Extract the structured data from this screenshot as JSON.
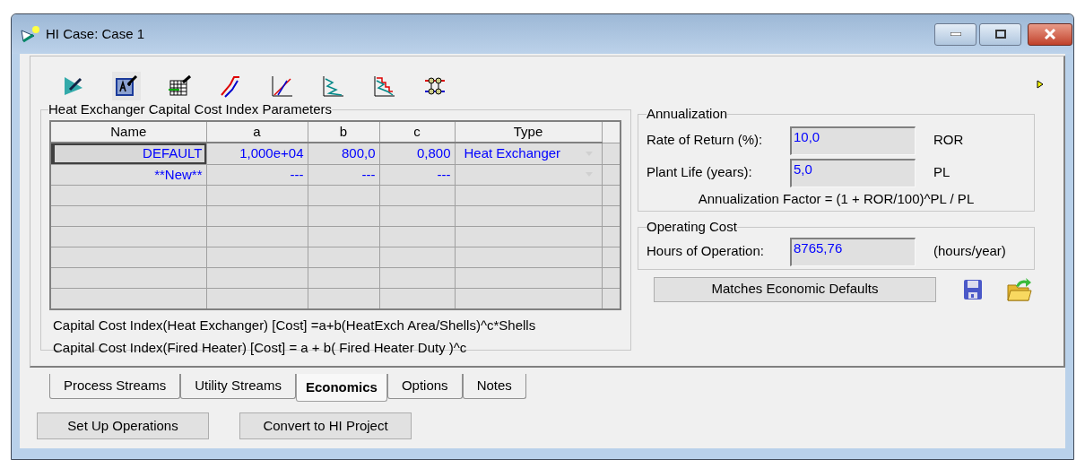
{
  "window": {
    "title": "HI Case: Case 1"
  },
  "capital_cost": {
    "title": "Heat Exchanger Capital Cost Index Parameters",
    "columns": [
      "Name",
      "a",
      "b",
      "c",
      "Type"
    ],
    "rows": [
      {
        "name": "DEFAULT",
        "a": "1,000e+04",
        "b": "800,0",
        "c": "0,800",
        "type": "Heat Exchanger",
        "selected": true
      },
      {
        "name": "**New**",
        "a": "---",
        "b": "---",
        "c": "---",
        "type": "",
        "selected": false
      }
    ],
    "notes": [
      "Capital Cost Index(Heat Exchanger) [Cost] =a+b(HeatExch Area/Shells)^c*Shells",
      "Capital Cost Index(Fired Heater) [Cost] = a + b( Fired Heater Duty )^c"
    ]
  },
  "annualization": {
    "title": "Annualization",
    "fields": [
      {
        "label": "Rate of Return (%):",
        "value": "10,0",
        "unit": "ROR"
      },
      {
        "label": "Plant Life (years):",
        "value": "5,0",
        "unit": "PL"
      }
    ],
    "formula": "Annualization Factor = (1 + ROR/100)^PL / PL"
  },
  "operating_cost": {
    "title": "Operating Cost",
    "label": "Hours of Operation:",
    "value": "8765,76",
    "unit": "(hours/year)"
  },
  "defaults_button": "Matches Economic Defaults",
  "tabs": [
    {
      "label": "Process Streams",
      "selected": false
    },
    {
      "label": "Utility Streams",
      "selected": false
    },
    {
      "label": "Economics",
      "selected": true
    },
    {
      "label": "Options",
      "selected": false
    },
    {
      "label": "Notes",
      "selected": false
    }
  ],
  "buttons": [
    "Set Up Operations",
    "Convert to HI Project"
  ]
}
